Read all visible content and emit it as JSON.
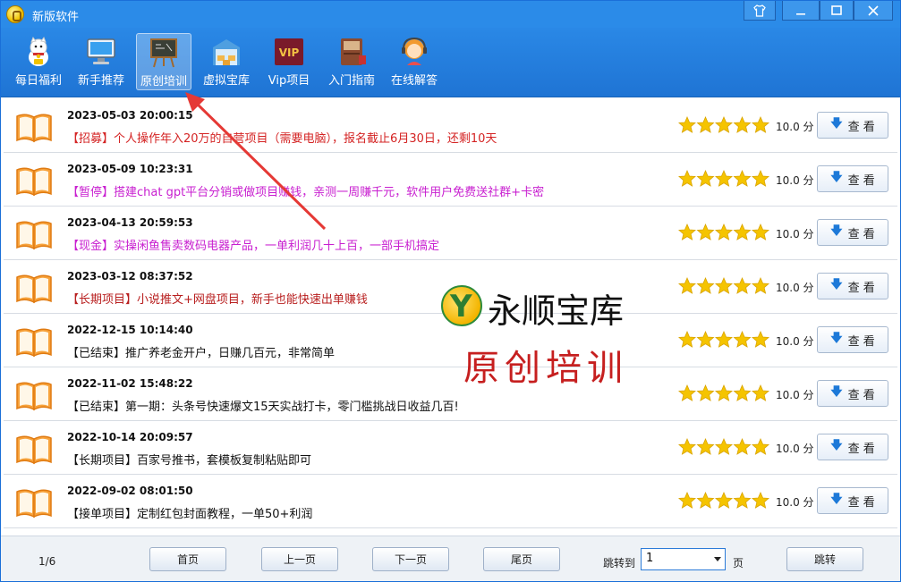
{
  "window": {
    "title": "新版软件",
    "controls": [
      "skin",
      "minimize",
      "maximize",
      "close"
    ]
  },
  "toolbar": {
    "items": [
      {
        "label": "每日福利",
        "icon": "lucky-cat-icon"
      },
      {
        "label": "新手推荐",
        "icon": "monitor-icon"
      },
      {
        "label": "原创培训",
        "icon": "chalkboard-icon",
        "active": true
      },
      {
        "label": "虚拟宝库",
        "icon": "warehouse-icon"
      },
      {
        "label": "Vip项目",
        "icon": "vip-icon"
      },
      {
        "label": "入门指南",
        "icon": "guide-book-icon"
      },
      {
        "label": "在线解答",
        "icon": "support-agent-icon"
      }
    ],
    "vip_badge_text": "VIP"
  },
  "list": {
    "view_label": "查 看",
    "items": [
      {
        "date": "2023-05-03 20:00:15",
        "text": "【招募】个人操作年入20万的自营项目（需要电脑），报名截止6月30日，还剩10天",
        "color": "#d42323",
        "score": "10.0 分",
        "rating": 5
      },
      {
        "date": "2023-05-09 10:23:31",
        "text": "【暂停】搭建chat gpt平台分销或做项目赚钱，亲测一周赚千元，软件用户免费送社群+卡密",
        "color": "#c81fd0",
        "score": "10.0 分",
        "rating": 5
      },
      {
        "date": "2023-04-13 20:59:53",
        "text": "【现金】实操闲鱼售卖数码电器产品，一单利润几十上百，一部手机搞定",
        "color": "#c81fd0",
        "score": "10.0 分",
        "rating": 5
      },
      {
        "date": "2023-03-12 08:37:52",
        "text": "【长期项目】小说推文+网盘项目，新手也能快速出单赚钱",
        "color": "#b81e1e",
        "score": "10.0 分",
        "rating": 5
      },
      {
        "date": "2022-12-15 10:14:40",
        "text": "【已结束】推广养老金开户，日赚几百元，非常简单",
        "color": "#111111",
        "score": "10.0 分",
        "rating": 5
      },
      {
        "date": "2022-11-02 15:48:22",
        "text": "【已结束】第一期：头条号快速爆文15天实战打卡，零门槛挑战日收益几百!",
        "color": "#111111",
        "score": "10.0 分",
        "rating": 5
      },
      {
        "date": "2022-10-14 20:09:57",
        "text": "【长期项目】百家号推书，套模板复制粘贴即可",
        "color": "#111111",
        "score": "10.0 分",
        "rating": 5
      },
      {
        "date": "2022-09-02 08:01:50",
        "text": "【接单项目】定制红包封面教程，一单50+利润",
        "color": "#111111",
        "score": "10.0 分",
        "rating": 5
      }
    ]
  },
  "watermark": {
    "logo_letter": "Y",
    "name": "永顺宝库",
    "subtitle": "原创培训"
  },
  "pagination": {
    "page_info": "1/6",
    "first": "首页",
    "prev": "上一页",
    "next": "下一页",
    "last": "尾页",
    "jump_label": "跳转到",
    "jump_value": "1",
    "page_unit": "页",
    "jump_button": "跳转"
  },
  "colors": {
    "titlebar": "#2b8be8",
    "toolbar": "#2278d8",
    "star": "#f5c400",
    "annotation_arrow": "#e53935"
  }
}
